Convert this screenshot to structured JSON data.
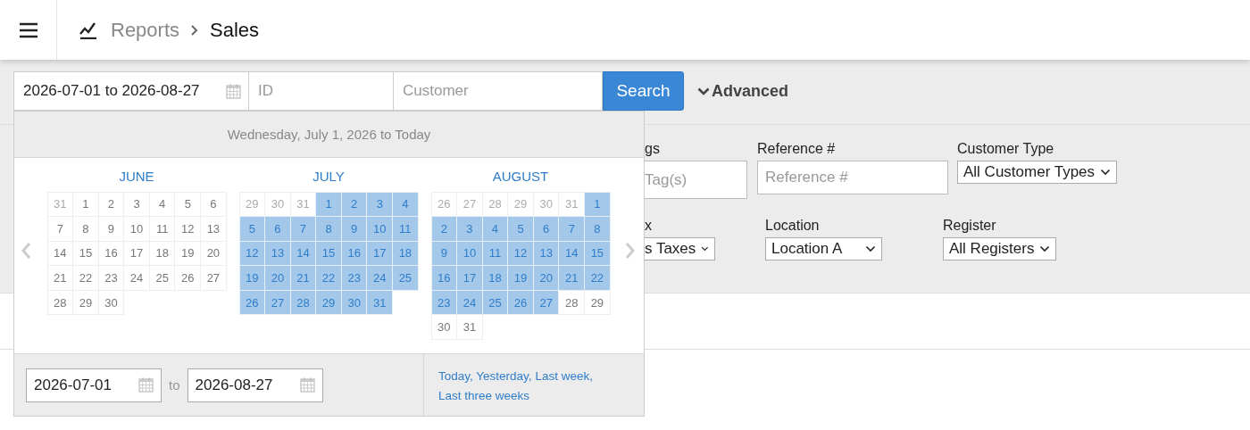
{
  "header": {
    "breadcrumb": [
      {
        "label": "Reports",
        "current": false
      },
      {
        "label": "Sales",
        "current": true
      }
    ]
  },
  "search_bar": {
    "date_range": "2026-07-01 to 2026-08-27",
    "id_placeholder": "ID",
    "customer_placeholder": "Customer",
    "search_button": "Search",
    "advanced": "Advanced"
  },
  "filters": [
    [
      {
        "label": "gs",
        "kind": "text",
        "placeholder": "Tag(s)"
      },
      {
        "label": "Reference #",
        "kind": "text",
        "placeholder": "Reference #"
      },
      {
        "label": "Customer Type",
        "kind": "select",
        "value": "All Customer Types"
      }
    ],
    [
      {
        "label": "x",
        "kind": "select",
        "value": "s Taxes"
      },
      {
        "label": "Location",
        "kind": "select",
        "value": "Location A"
      },
      {
        "label": "Register",
        "kind": "select",
        "value": "All Registers"
      }
    ]
  ],
  "date_picker": {
    "summary": "Wednesday, July 1, 2026 to Today",
    "months": [
      {
        "name": "JUNE",
        "days": [
          {
            "day": "31",
            "kind": "outside",
            "selected": false
          },
          {
            "day": "1",
            "kind": "day",
            "selected": false
          },
          {
            "day": "2",
            "kind": "day",
            "selected": false
          },
          {
            "day": "3",
            "kind": "day",
            "selected": false
          },
          {
            "day": "4",
            "kind": "day",
            "selected": false
          },
          {
            "day": "5",
            "kind": "day",
            "selected": false
          },
          {
            "day": "6",
            "kind": "day",
            "selected": false
          },
          {
            "day": "7",
            "kind": "day",
            "selected": false
          },
          {
            "day": "8",
            "kind": "day",
            "selected": false
          },
          {
            "day": "9",
            "kind": "day",
            "selected": false
          },
          {
            "day": "10",
            "kind": "day",
            "selected": false
          },
          {
            "day": "11",
            "kind": "day",
            "selected": false
          },
          {
            "day": "12",
            "kind": "day",
            "selected": false
          },
          {
            "day": "13",
            "kind": "day",
            "selected": false
          },
          {
            "day": "14",
            "kind": "day",
            "selected": false
          },
          {
            "day": "15",
            "kind": "day",
            "selected": false
          },
          {
            "day": "16",
            "kind": "day",
            "selected": false
          },
          {
            "day": "17",
            "kind": "day",
            "selected": false
          },
          {
            "day": "18",
            "kind": "day",
            "selected": false
          },
          {
            "day": "19",
            "kind": "day",
            "selected": false
          },
          {
            "day": "20",
            "kind": "day",
            "selected": false
          },
          {
            "day": "21",
            "kind": "day",
            "selected": false
          },
          {
            "day": "22",
            "kind": "day",
            "selected": false
          },
          {
            "day": "23",
            "kind": "day",
            "selected": false
          },
          {
            "day": "24",
            "kind": "day",
            "selected": false
          },
          {
            "day": "25",
            "kind": "day",
            "selected": false
          },
          {
            "day": "26",
            "kind": "day",
            "selected": false
          },
          {
            "day": "27",
            "kind": "day",
            "selected": false
          },
          {
            "day": "28",
            "kind": "day",
            "selected": false
          },
          {
            "day": "29",
            "kind": "day",
            "selected": false
          },
          {
            "day": "30",
            "kind": "day",
            "selected": false
          }
        ]
      },
      {
        "name": "JULY",
        "days": [
          {
            "day": "29",
            "kind": "outside",
            "selected": false
          },
          {
            "day": "30",
            "kind": "outside",
            "selected": false
          },
          {
            "day": "31",
            "kind": "outside",
            "selected": false
          },
          {
            "day": "1",
            "kind": "day",
            "selected": true
          },
          {
            "day": "2",
            "kind": "day",
            "selected": true
          },
          {
            "day": "3",
            "kind": "day",
            "selected": true
          },
          {
            "day": "4",
            "kind": "day",
            "selected": true
          },
          {
            "day": "5",
            "kind": "day",
            "selected": true
          },
          {
            "day": "6",
            "kind": "day",
            "selected": true
          },
          {
            "day": "7",
            "kind": "day",
            "selected": true
          },
          {
            "day": "8",
            "kind": "day",
            "selected": true
          },
          {
            "day": "9",
            "kind": "day",
            "selected": true
          },
          {
            "day": "10",
            "kind": "day",
            "selected": true
          },
          {
            "day": "11",
            "kind": "day",
            "selected": true
          },
          {
            "day": "12",
            "kind": "day",
            "selected": true
          },
          {
            "day": "13",
            "kind": "day",
            "selected": true
          },
          {
            "day": "14",
            "kind": "day",
            "selected": true
          },
          {
            "day": "15",
            "kind": "day",
            "selected": true
          },
          {
            "day": "16",
            "kind": "day",
            "selected": true
          },
          {
            "day": "17",
            "kind": "day",
            "selected": true
          },
          {
            "day": "18",
            "kind": "day",
            "selected": true
          },
          {
            "day": "19",
            "kind": "day",
            "selected": true
          },
          {
            "day": "20",
            "kind": "day",
            "selected": true
          },
          {
            "day": "21",
            "kind": "day",
            "selected": true
          },
          {
            "day": "22",
            "kind": "day",
            "selected": true
          },
          {
            "day": "23",
            "kind": "day",
            "selected": true
          },
          {
            "day": "24",
            "kind": "day",
            "selected": true
          },
          {
            "day": "25",
            "kind": "day",
            "selected": true
          },
          {
            "day": "26",
            "kind": "day",
            "selected": true
          },
          {
            "day": "27",
            "kind": "day",
            "selected": true
          },
          {
            "day": "28",
            "kind": "day",
            "selected": true
          },
          {
            "day": "29",
            "kind": "day",
            "selected": true
          },
          {
            "day": "30",
            "kind": "day",
            "selected": true
          },
          {
            "day": "31",
            "kind": "day",
            "selected": true
          }
        ]
      },
      {
        "name": "AUGUST",
        "days": [
          {
            "day": "26",
            "kind": "outside",
            "selected": false
          },
          {
            "day": "27",
            "kind": "outside",
            "selected": false
          },
          {
            "day": "28",
            "kind": "outside",
            "selected": false
          },
          {
            "day": "29",
            "kind": "outside",
            "selected": false
          },
          {
            "day": "30",
            "kind": "outside",
            "selected": false
          },
          {
            "day": "31",
            "kind": "outside",
            "selected": false
          },
          {
            "day": "1",
            "kind": "day",
            "selected": true
          },
          {
            "day": "2",
            "kind": "day",
            "selected": true
          },
          {
            "day": "3",
            "kind": "day",
            "selected": true
          },
          {
            "day": "4",
            "kind": "day",
            "selected": true
          },
          {
            "day": "5",
            "kind": "day",
            "selected": true
          },
          {
            "day": "6",
            "kind": "day",
            "selected": true
          },
          {
            "day": "7",
            "kind": "day",
            "selected": true
          },
          {
            "day": "8",
            "kind": "day",
            "selected": true
          },
          {
            "day": "9",
            "kind": "day",
            "selected": true
          },
          {
            "day": "10",
            "kind": "day",
            "selected": true
          },
          {
            "day": "11",
            "kind": "day",
            "selected": true
          },
          {
            "day": "12",
            "kind": "day",
            "selected": true
          },
          {
            "day": "13",
            "kind": "day",
            "selected": true
          },
          {
            "day": "14",
            "kind": "day",
            "selected": true
          },
          {
            "day": "15",
            "kind": "day",
            "selected": true
          },
          {
            "day": "16",
            "kind": "day",
            "selected": true
          },
          {
            "day": "17",
            "kind": "day",
            "selected": true
          },
          {
            "day": "18",
            "kind": "day",
            "selected": true
          },
          {
            "day": "19",
            "kind": "day",
            "selected": true
          },
          {
            "day": "20",
            "kind": "day",
            "selected": true
          },
          {
            "day": "21",
            "kind": "day",
            "selected": true
          },
          {
            "day": "22",
            "kind": "day",
            "selected": true
          },
          {
            "day": "23",
            "kind": "day",
            "selected": true
          },
          {
            "day": "24",
            "kind": "day",
            "selected": true
          },
          {
            "day": "25",
            "kind": "day",
            "selected": true
          },
          {
            "day": "26",
            "kind": "day",
            "selected": true
          },
          {
            "day": "27",
            "kind": "day",
            "selected": true
          },
          {
            "day": "28",
            "kind": "day",
            "selected": false
          },
          {
            "day": "29",
            "kind": "day",
            "selected": false
          },
          {
            "day": "30",
            "kind": "day",
            "selected": false
          },
          {
            "day": "31",
            "kind": "day",
            "selected": false
          }
        ]
      }
    ],
    "start": "2026-07-01",
    "to": "to",
    "end": "2026-08-27",
    "shortcuts": [
      {
        "label": "Today"
      },
      {
        "label": "Yesterday"
      },
      {
        "label": "Last week"
      },
      {
        "label": "Last three weeks"
      }
    ],
    "separator": ","
  }
}
